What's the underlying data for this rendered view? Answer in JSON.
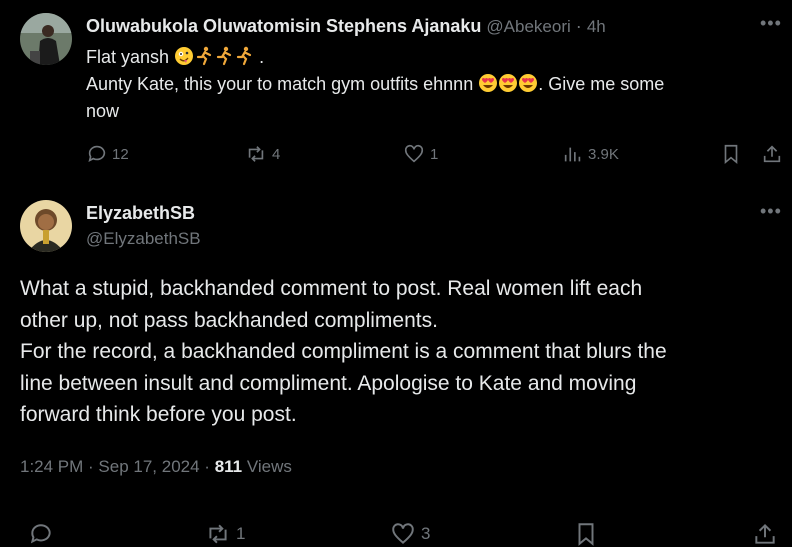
{
  "reply": {
    "display_name": "Oluwabukola Oluwatomisin Stephens Ajanaku",
    "handle": "@Abekeori",
    "separator": "·",
    "time_ago": "4h",
    "line1_text": "Flat yansh",
    "line1_emojis": [
      "zany-face",
      "runner",
      "runner",
      "runner"
    ],
    "line1_tail": ".",
    "line2_text": "Aunty Kate, this your to match gym outfits ehnnn",
    "line2_emojis": [
      "heart-eyes",
      "heart-eyes",
      "heart-eyes"
    ],
    "line2_tail": ". Give me some",
    "line3_text": "now",
    "replies": "12",
    "reposts": "4",
    "likes": "1",
    "views": "3.9K"
  },
  "main": {
    "display_name": "ElyzabethSB",
    "handle": "@ElyzabethSB",
    "body_lines": [
      "What a stupid, backhanded comment to post. Real women lift each",
      "other up, not pass backhanded compliments.",
      "For the record, a backhanded compliment is a comment that blurs the",
      "line between insult and compliment. Apologise to Kate and moving",
      "forward think before you post."
    ],
    "timestamp": "1:24 PM · Sep 17, 2024 ·",
    "views_count": "811",
    "views_label": "Views",
    "reposts": "1",
    "likes": "3"
  },
  "colors": {
    "background": "#000000",
    "text": "#e7e9ea",
    "muted": "#71767b"
  }
}
